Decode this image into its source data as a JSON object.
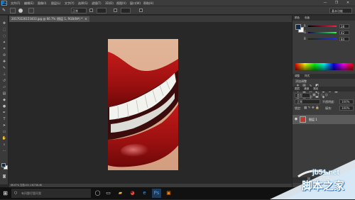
{
  "app": {
    "logo": "Ps"
  },
  "menubar": {
    "items": [
      "文件(F)",
      "编辑(E)",
      "图像(I)",
      "图层(L)",
      "文字(Y)",
      "选择(S)",
      "滤镜(T)",
      "3D(D)",
      "视图(V)",
      "窗口(W)",
      "帮助(H)"
    ],
    "window_controls": {
      "minimize": "—",
      "restore": "❐",
      "close": "✕"
    }
  },
  "options_bar": {
    "mode_value": "正常",
    "workspace": "基本功能"
  },
  "document": {
    "tab_title": "20170226151833.jpg @ 66.7% (图层 1, RGB/8#) *",
    "close": "×",
    "status": "66.67%    文档:411.1K/748.4K"
  },
  "panels": {
    "color": {
      "tabs": [
        "颜色",
        "色板"
      ],
      "sliders": [
        {
          "label": "R",
          "value": "28",
          "gradient": [
            "#000000",
            "#ff1c50"
          ]
        },
        {
          "label": "G",
          "value": "42",
          "gradient": [
            "#1c0050",
            "#1cff50"
          ]
        },
        {
          "label": "B",
          "value": "84",
          "gradient": [
            "#1c2a00",
            "#1c2aff"
          ]
        }
      ],
      "foreground": "#10294f",
      "background": "#ffffff"
    },
    "adjustments": {
      "tabs": [
        "调整",
        "样式"
      ],
      "title": "添加调整",
      "icons": [
        "brightness-icon",
        "levels-icon",
        "curves-icon",
        "exposure-icon",
        "vibrance-icon",
        "hue-icon",
        "colorbalance-icon",
        "bw-icon",
        "photofilter-icon",
        "channelmixer-icon",
        "lookup-icon",
        "invert-icon",
        "posterize-icon",
        "threshold-icon",
        "gradientmap-icon",
        "selectivecolor-icon"
      ]
    },
    "layers": {
      "tabs": [
        "图层",
        "通道",
        "路径"
      ],
      "kind_filter": "类型",
      "blend_mode": "正常",
      "opacity_label": "不透明度:",
      "opacity": "100%",
      "lock_label": "锁定:",
      "fill_label": "填充:",
      "fill": "100%",
      "layer_name": "图层 1"
    }
  },
  "taskbar": {
    "search_placeholder": "有问题尽管问我",
    "time": "",
    "apps": [
      "task-view-icon",
      "edge-icon",
      "explorer-icon",
      "store-icon",
      "ps-icon",
      "sketch-icon"
    ]
  },
  "watermark": {
    "site": "jb51.net",
    "text": "脚本之家"
  }
}
